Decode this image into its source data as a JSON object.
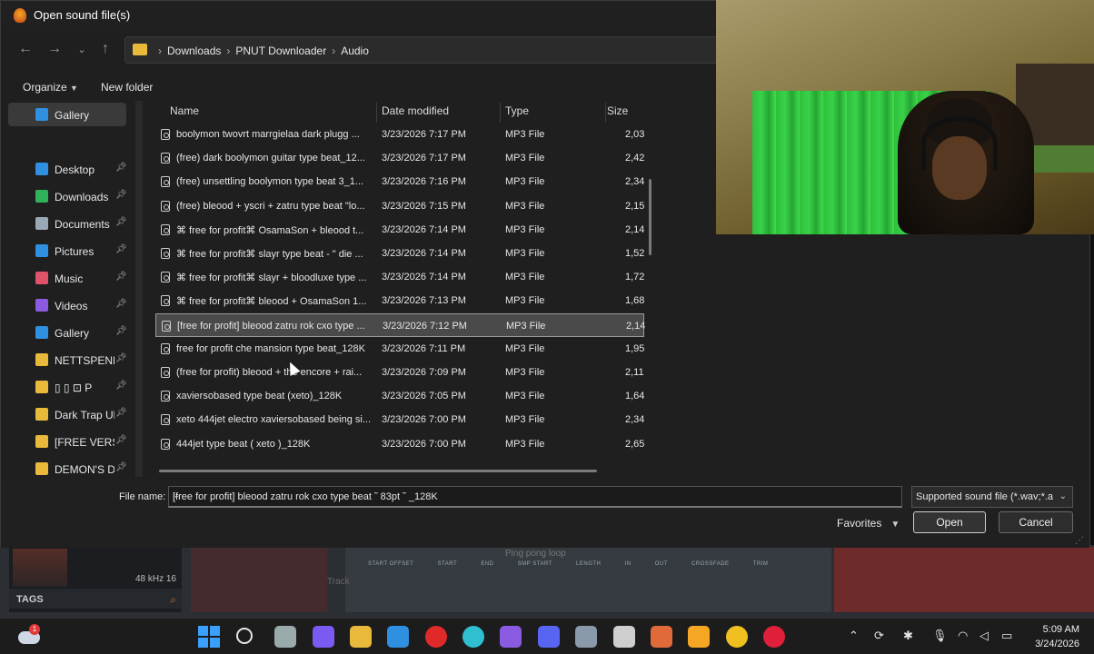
{
  "window": {
    "title": "Open sound file(s)"
  },
  "address": {
    "crumbs": [
      "Downloads",
      "PNUT Downloader",
      "Audio"
    ]
  },
  "commands": {
    "organize": "Organize",
    "new_folder": "New folder"
  },
  "sidebar": {
    "items": [
      {
        "label": "Gallery",
        "icon": "gallery-icon",
        "color": "#2f8fe0",
        "pinned": false,
        "active": true
      },
      {
        "label": "Desktop",
        "icon": "desktop-icon",
        "color": "#2f8fe0",
        "pinned": true
      },
      {
        "label": "Downloads",
        "icon": "download-icon",
        "color": "#2fb25a",
        "pinned": true
      },
      {
        "label": "Documents",
        "icon": "documents-icon",
        "color": "#9aa7b5",
        "pinned": true
      },
      {
        "label": "Pictures",
        "icon": "pictures-icon",
        "color": "#2f8fe0",
        "pinned": true
      },
      {
        "label": "Music",
        "icon": "music-icon",
        "color": "#e0526a",
        "pinned": true
      },
      {
        "label": "Videos",
        "icon": "videos-icon",
        "color": "#8a5ae0",
        "pinned": true
      },
      {
        "label": "Gallery",
        "icon": "gallery-icon",
        "color": "#2f8fe0",
        "pinned": true
      },
      {
        "label": "NETTSPEND",
        "icon": "folder-icon",
        "color": "#e8b93a",
        "pinned": true
      },
      {
        "label": "▯   ▯   ⊡ P",
        "icon": "folder-icon",
        "color": "#e8b93a",
        "pinned": true
      },
      {
        "label": "Dark Trap Ult",
        "icon": "folder-icon",
        "color": "#e8b93a",
        "pinned": true
      },
      {
        "label": "[FREE VERSIC",
        "icon": "folder-icon",
        "color": "#e8b93a",
        "pinned": true
      },
      {
        "label": "DEMON'S DF",
        "icon": "folder-icon",
        "color": "#e8b93a",
        "pinned": true
      }
    ]
  },
  "columns": {
    "name": "Name",
    "date": "Date modified",
    "type": "Type",
    "size": "Size"
  },
  "files": [
    {
      "name": "boolymon twovrt marrgielaa dark plugg ...",
      "date": "3/23/2026 7:17 PM",
      "type": "MP3 File",
      "size": "2,03"
    },
    {
      "name": "(free) dark boolymon guitar type beat_12...",
      "date": "3/23/2026 7:17 PM",
      "type": "MP3 File",
      "size": "2,42"
    },
    {
      "name": "(free) unsettling boolymon type beat 3_1...",
      "date": "3/23/2026 7:16 PM",
      "type": "MP3 File",
      "size": "2,34"
    },
    {
      "name": "(free) bleood + yscri + zatru type beat \"lo...",
      "date": "3/23/2026 7:15 PM",
      "type": "MP3 File",
      "size": "2,15"
    },
    {
      "name": "⌘ free for profit⌘ OsamaSon + bleood t...",
      "date": "3/23/2026 7:14 PM",
      "type": "MP3 File",
      "size": "2,14"
    },
    {
      "name": "⌘ free for profit⌘ slayr type beat - \" die ...",
      "date": "3/23/2026 7:14 PM",
      "type": "MP3 File",
      "size": "1,52"
    },
    {
      "name": "⌘ free for profit⌘ slayr + bloodluxe type ...",
      "date": "3/23/2026 7:14 PM",
      "type": "MP3 File",
      "size": "1,72"
    },
    {
      "name": "⌘ free for profit⌘ bleood + OsamaSon 1...",
      "date": "3/23/2026 7:13 PM",
      "type": "MP3 File",
      "size": "1,68"
    },
    {
      "name": "[free for profit] bleood zatru rok cxo type ...",
      "date": "3/23/2026 7:12 PM",
      "type": "MP3 File",
      "size": "2,14",
      "selected": true
    },
    {
      "name": "free for profit che mansion type beat_128K",
      "date": "3/23/2026 7:11 PM",
      "type": "MP3 File",
      "size": "1,95"
    },
    {
      "name": "(free for profit) bleood + the encore + rai...",
      "date": "3/23/2026 7:09 PM",
      "type": "MP3 File",
      "size": "2,11"
    },
    {
      "name": "xaviersobased type beat (xeto)_128K",
      "date": "3/23/2026 7:05 PM",
      "type": "MP3 File",
      "size": "1,64"
    },
    {
      "name": "xeto 444jet electro xaviersobased being si...",
      "date": "3/23/2026 7:00 PM",
      "type": "MP3 File",
      "size": "2,34"
    },
    {
      "name": "444jet type beat ( xeto )_128K",
      "date": "3/23/2026 7:00 PM",
      "type": "MP3 File",
      "size": "2,65"
    }
  ],
  "bottom": {
    "file_name_label": "File name:",
    "file_name_value": "[free for profit] bleood zatru rok cxo type beat ˜ 83pt ˜ _128K",
    "filter": "Supported sound file (*.wav;*.a",
    "favorites": "Favorites",
    "open": "Open",
    "cancel": "Cancel"
  },
  "daw": {
    "tags": "TAGS",
    "khz": "48 kHz 16",
    "ping_pong": "Ping pong loop",
    "track": "Track",
    "knobs": [
      "START OFFSET",
      "START",
      "END",
      "SMP START",
      "LENGTH",
      "IN",
      "OUT",
      "CROSSFADE",
      "TRIM"
    ]
  },
  "taskbar": {
    "weather_badge": "1",
    "time": "5:09 AM",
    "date": "3/24/2026",
    "apps": [
      {
        "icon": "start-icon",
        "color": "#3aa0ff"
      },
      {
        "icon": "search-icon",
        "color": "#e6e6e6"
      },
      {
        "icon": "task-view-icon",
        "color": "#9aa"
      },
      {
        "icon": "copilot-icon",
        "color": "#7a5af0"
      },
      {
        "icon": "file-explorer-icon",
        "color": "#e8b93a"
      },
      {
        "icon": "outlook-icon",
        "color": "#2f8fe0"
      },
      {
        "icon": "opera-icon",
        "color": "#e02a2a"
      },
      {
        "icon": "edge-icon",
        "color": "#2fbfd0"
      },
      {
        "icon": "clipchamp-icon",
        "color": "#8a5ae0"
      },
      {
        "icon": "discord-icon",
        "color": "#5865f2"
      },
      {
        "icon": "camera-icon",
        "color": "#8a9aaa"
      },
      {
        "icon": "steam-icon",
        "color": "#cfcfcf"
      },
      {
        "icon": "game-icon",
        "color": "#e06a3a"
      },
      {
        "icon": "fl-studio-icon",
        "color": "#f5a623"
      },
      {
        "icon": "chrome-icon",
        "color": "#f0c020"
      },
      {
        "icon": "opera-gx-icon",
        "color": "#e0203a"
      }
    ]
  }
}
